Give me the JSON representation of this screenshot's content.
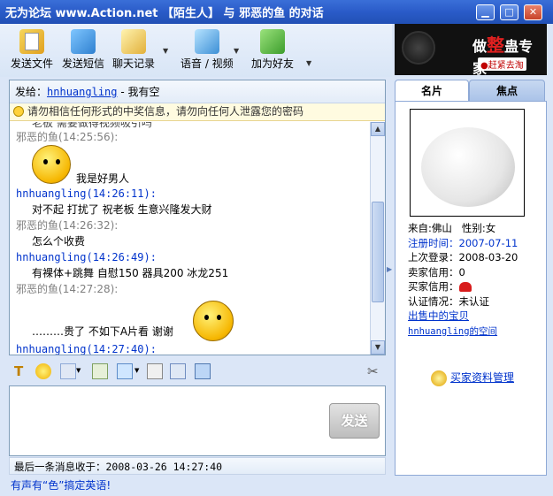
{
  "window": {
    "title": "无为论坛 www.Action.net 【陌生人】 与 邪恶的鱼 的对话",
    "min_label": "▁",
    "max_label": "□",
    "close_label": "✕"
  },
  "toolbar": {
    "send_file": "发送文件",
    "send_sms": "发送短信",
    "chat_history": "聊天记录",
    "voice_video": "语音 / 视频",
    "add_friend": "加为好友"
  },
  "ad": {
    "text_prefix": "做",
    "text_big": "整",
    "text_suffix": "蛊专家",
    "tag": "●赶紧去淘"
  },
  "chat": {
    "send_to_label": "发给：",
    "send_to_user": "hnhuangling",
    "send_to_status": " - 我有空",
    "warning": "请勿相信任何形式的中奖信息，请勿向任何人泄露您的密码",
    "partial_top": "老板 需要做得视频吸引吗",
    "messages": [
      {
        "sender": "邪恶的鱼",
        "time": "(14:25:56):",
        "text": "我是好男人",
        "side": "me"
      },
      {
        "sender": "hnhuangling",
        "time": "(14:26:11):",
        "text": "对不起 打扰了  祝老板 生意兴隆发大财",
        "side": "other"
      },
      {
        "sender": "邪恶的鱼",
        "time": "(14:26:32):",
        "text": "怎么个收费",
        "side": "me"
      },
      {
        "sender": "hnhuangling",
        "time": "(14:26:49):",
        "text": "有裸体+跳舞 自慰150  器具200 冰龙251",
        "side": "other"
      },
      {
        "sender": "邪恶的鱼",
        "time": "(14:27:28):",
        "text": "………贵了 不如下A片看 谢谢",
        "side": "me"
      },
      {
        "sender": "hnhuangling",
        "time": "(14:27:40):",
        "text": "",
        "side": "other"
      }
    ]
  },
  "send_button": "发送",
  "status": {
    "last_msg_label": "最后一条消息收于：",
    "last_msg_time": "2008-03-26 14:27:40"
  },
  "promo": "有声有“色”搞定英语!",
  "side": {
    "tab_card": "名片",
    "tab_focus": "焦点",
    "from_label": "来自:",
    "from_value": "佛山",
    "gender_label": "性别:",
    "gender_value": "女",
    "reg_label": "注册时间：",
    "reg_value": "2007-07-11",
    "last_login_label": "上次登录：",
    "last_login_value": "2008-03-20",
    "seller_credit_label": "卖家信用：",
    "seller_credit_value": "0",
    "buyer_credit_label": "买家信用：",
    "verify_label": "认证情况：",
    "verify_value": "未认证",
    "on_sale_link": "出售中的宝贝",
    "space_link": "hnhuangling的空间",
    "manage_link": "买家资料管理"
  }
}
